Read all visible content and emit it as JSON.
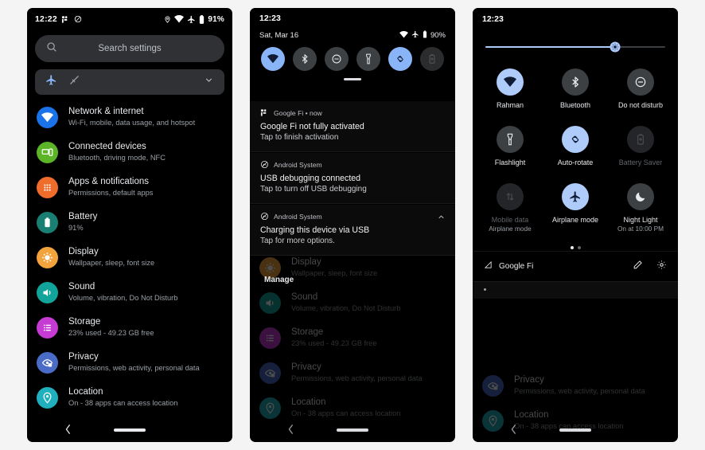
{
  "panel1": {
    "status": {
      "time": "12:22",
      "left_icons": [
        "google-fi-icon",
        "dnd-icon"
      ],
      "right_icons": [
        "location-icon",
        "wifi-icon",
        "airplane-icon",
        "battery-icon"
      ],
      "battery": "91%"
    },
    "search": {
      "placeholder": "Search settings",
      "icon": "search-icon"
    },
    "suggestion": {
      "icons": [
        "airplane-icon",
        "slash-icon"
      ],
      "chevron": "chevron-down-icon"
    },
    "settings": [
      {
        "title": "Network & internet",
        "subtitle": "Wi-Fi, mobile, data usage, and hotspot",
        "icon": "wifi-icon",
        "color": "#1a73e8"
      },
      {
        "title": "Connected devices",
        "subtitle": "Bluetooth, driving mode, NFC",
        "icon": "devices-icon",
        "color": "#5bb526"
      },
      {
        "title": "Apps & notifications",
        "subtitle": "Permissions, default apps",
        "icon": "apps-grid-icon",
        "color": "#ef6c2b"
      },
      {
        "title": "Battery",
        "subtitle": "91%",
        "icon": "battery-icon",
        "color": "#1a7f73"
      },
      {
        "title": "Display",
        "subtitle": "Wallpaper, sleep, font size",
        "icon": "brightness-icon",
        "color": "#f2a33c"
      },
      {
        "title": "Sound",
        "subtitle": "Volume, vibration, Do Not Disturb",
        "icon": "volume-icon",
        "color": "#12a39a"
      },
      {
        "title": "Storage",
        "subtitle": "23% used - 49.23 GB free",
        "icon": "storage-icon",
        "color": "#c63bd3"
      },
      {
        "title": "Privacy",
        "subtitle": "Permissions, web activity, personal data",
        "icon": "privacy-eye-icon",
        "color": "#4a6cc7"
      },
      {
        "title": "Location",
        "subtitle": "On - 38 apps can access location",
        "icon": "location-pin-icon",
        "color": "#20b0bd"
      }
    ],
    "nav": {
      "back": "back-icon",
      "home": "home-pill"
    }
  },
  "panel2": {
    "status": {
      "time": "12:23"
    },
    "shade_header": {
      "date": "Sat, Mar 16",
      "battery": "90%",
      "icons": [
        "wifi-icon",
        "airplane-icon",
        "battery-icon"
      ]
    },
    "quick_tiles": [
      {
        "name": "wifi-tile",
        "icon": "wifi-icon",
        "state": "on"
      },
      {
        "name": "bluetooth-tile",
        "icon": "bluetooth-icon",
        "state": "off"
      },
      {
        "name": "dnd-tile",
        "icon": "dnd-icon",
        "state": "off"
      },
      {
        "name": "flashlight-tile",
        "icon": "flashlight-icon",
        "state": "off"
      },
      {
        "name": "auto-rotate-tile",
        "icon": "auto-rotate-icon",
        "state": "on"
      },
      {
        "name": "battery-saver-tile",
        "icon": "battery-saver-icon",
        "state": "disabled"
      }
    ],
    "notifications": [
      {
        "app": "Google Fi",
        "meta": "• now",
        "icon": "google-fi-icon",
        "title": "Google Fi not fully activated",
        "subtitle": "Tap to finish activation",
        "expand": false
      },
      {
        "app": "Android System",
        "meta": "",
        "icon": "android-system-icon",
        "title": "USB debugging connected",
        "subtitle": "Tap to turn off USB debugging",
        "expand": false
      },
      {
        "app": "Android System",
        "meta": "",
        "icon": "android-system-icon",
        "title": "Charging this device via USB",
        "subtitle": "Tap for more options.",
        "expand": true
      }
    ],
    "manage_label": "Manage",
    "background_settings": [
      {
        "title": "Display",
        "subtitle": "Wallpaper, sleep, font size",
        "color": "#f2a33c",
        "icon": "brightness-icon"
      },
      {
        "title": "Sound",
        "subtitle": "Volume, vibration, Do Not Disturb",
        "color": "#12a39a",
        "icon": "volume-icon"
      },
      {
        "title": "Storage",
        "subtitle": "23% used - 49.23 GB free",
        "color": "#c63bd3",
        "icon": "storage-icon"
      },
      {
        "title": "Privacy",
        "subtitle": "Permissions, web activity, personal data",
        "color": "#4a6cc7",
        "icon": "privacy-eye-icon"
      },
      {
        "title": "Location",
        "subtitle": "On - 38 apps can access location",
        "color": "#20b0bd",
        "icon": "location-pin-icon"
      }
    ]
  },
  "panel3": {
    "status": {
      "time": "12:23"
    },
    "brightness": {
      "value": 72,
      "icon": "brightness-icon"
    },
    "tiles": [
      {
        "label": "Rahman",
        "sublabel": "",
        "icon": "wifi-icon",
        "state": "on"
      },
      {
        "label": "Bluetooth",
        "sublabel": "",
        "icon": "bluetooth-icon",
        "state": "off"
      },
      {
        "label": "Do not disturb",
        "sublabel": "",
        "icon": "dnd-icon",
        "state": "off"
      },
      {
        "label": "Flashlight",
        "sublabel": "",
        "icon": "flashlight-icon",
        "state": "off"
      },
      {
        "label": "Auto-rotate",
        "sublabel": "",
        "icon": "auto-rotate-icon",
        "state": "on"
      },
      {
        "label": "Battery Saver",
        "sublabel": "",
        "icon": "battery-saver-icon",
        "state": "disabled"
      },
      {
        "label": "Mobile data",
        "sublabel": "Airplane mode",
        "icon": "mobile-data-icon",
        "state": "disabled"
      },
      {
        "label": "Airplane mode",
        "sublabel": "",
        "icon": "airplane-icon",
        "state": "on"
      },
      {
        "label": "Night Light",
        "sublabel": "On at 10:00 PM",
        "icon": "night-light-icon",
        "state": "off"
      }
    ],
    "pages": {
      "count": 2,
      "active": 0
    },
    "footer": {
      "carrier": "Google Fi",
      "signal_icon": "signal-triangle-icon",
      "edit_icon": "pencil-icon",
      "settings_icon": "gear-icon"
    },
    "background_settings": [
      {
        "title": "Privacy",
        "subtitle": "Permissions, web activity, personal data",
        "color": "#4a6cc7",
        "icon": "privacy-eye-icon"
      },
      {
        "title": "Location",
        "subtitle": "On - 38 apps can access location",
        "color": "#20b0bd",
        "icon": "location-pin-icon"
      }
    ]
  },
  "theme": {
    "accent": "#8ab4f8",
    "accent_light": "#aecbfa",
    "bg": "#000000",
    "surface": "#303134",
    "text": "#e8eaed",
    "text_secondary": "#9aa0a6"
  }
}
